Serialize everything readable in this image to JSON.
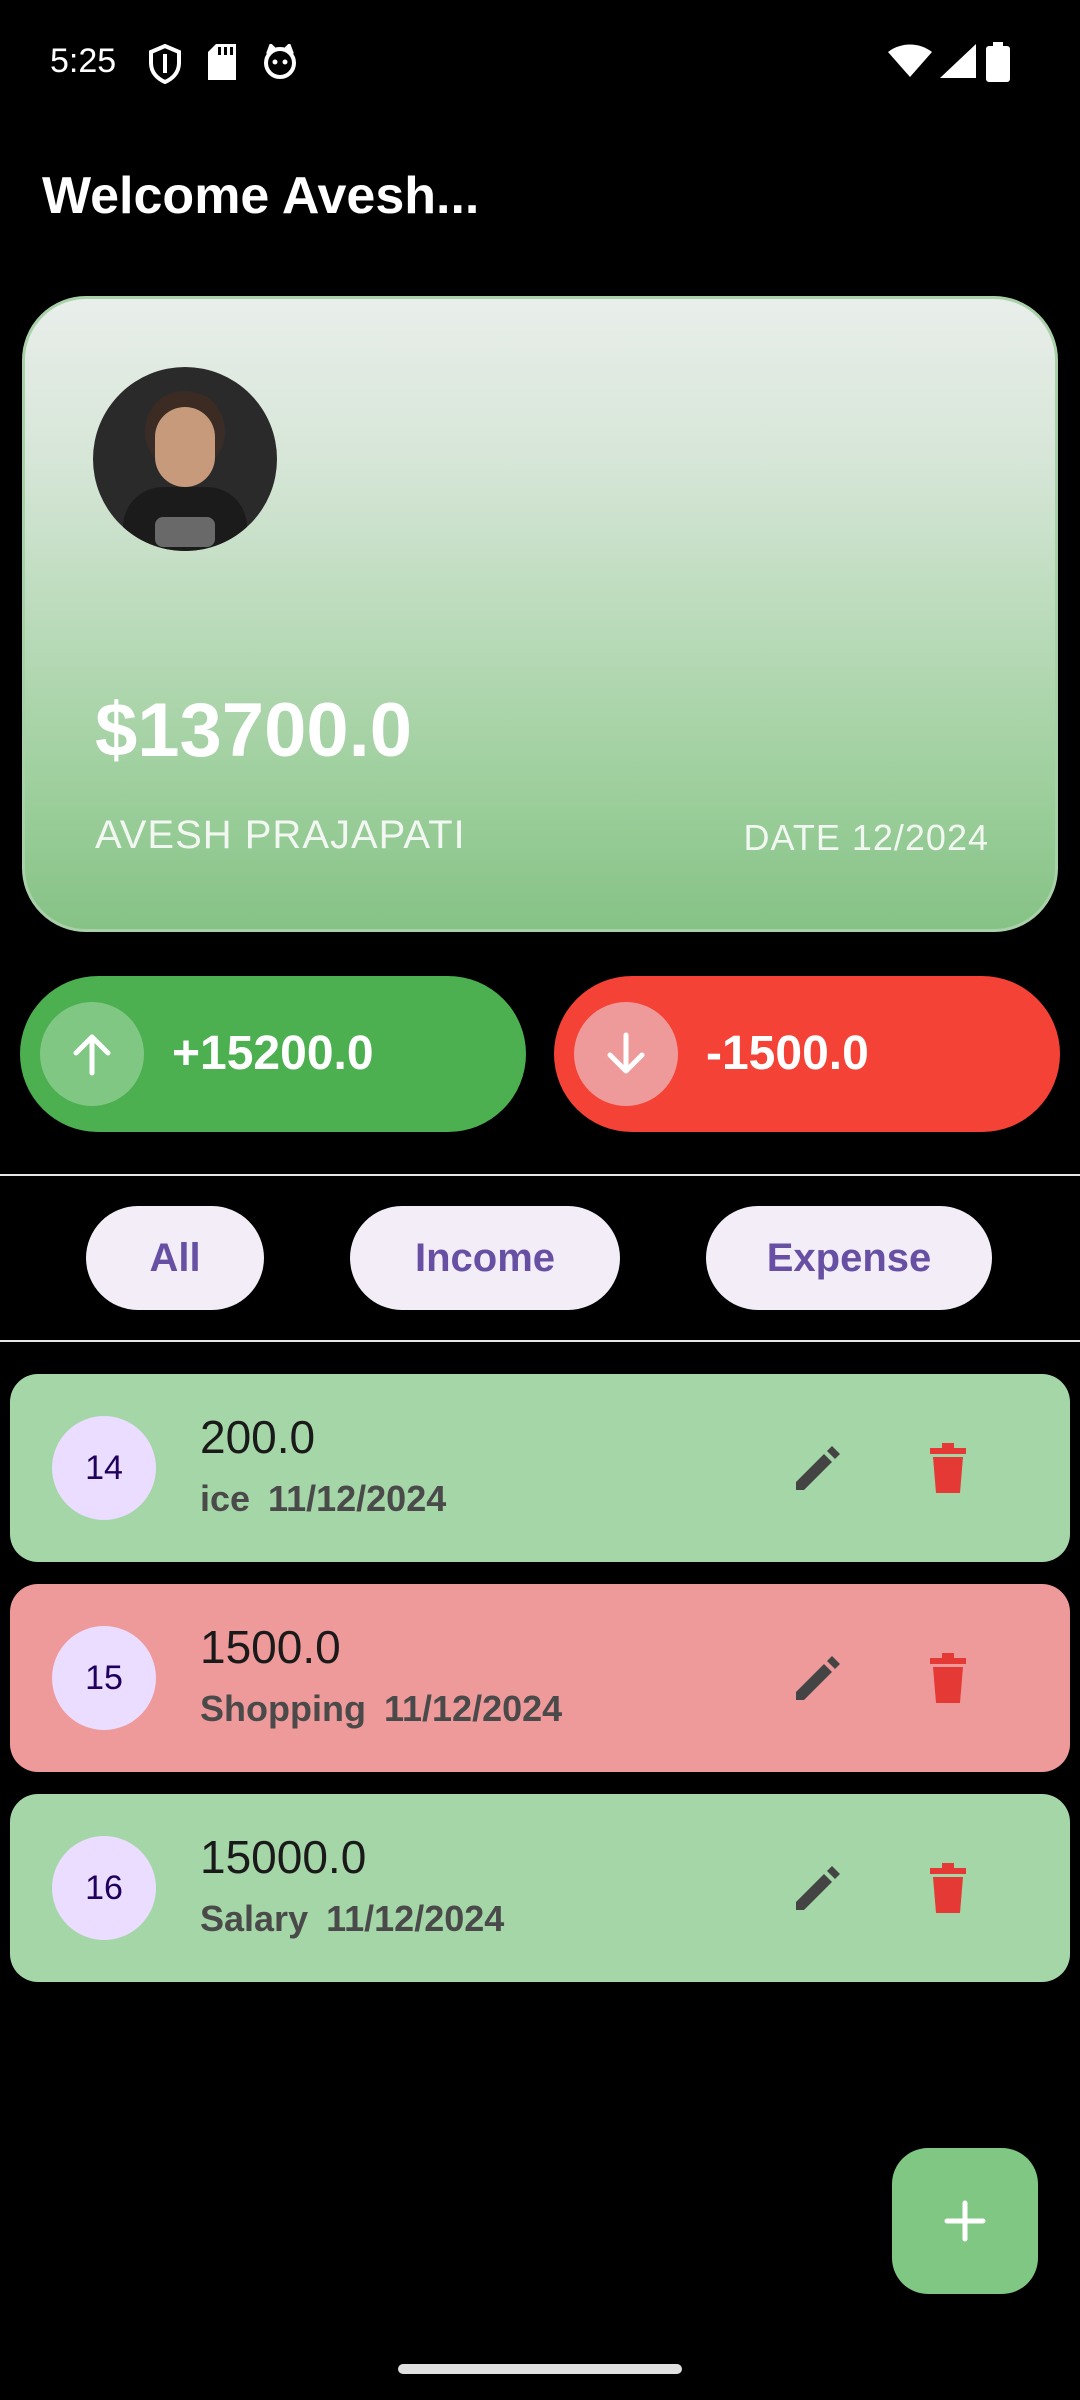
{
  "status_bar": {
    "time": "5:25",
    "icons": [
      "shield-icon",
      "sd-card-icon",
      "cat-icon",
      "wifi-icon",
      "signal-icon",
      "battery-icon"
    ]
  },
  "header": {
    "welcome": "Welcome Avesh..."
  },
  "card": {
    "balance": "$13700.0",
    "name": "AVESH PRAJAPATI",
    "date": "DATE 12/2024",
    "avatar_icon": "profile-avatar"
  },
  "summary": {
    "income": "+15200.0",
    "expense": "-1500.0",
    "income_icon": "arrow-up-icon",
    "expense_icon": "arrow-down-icon"
  },
  "filters": {
    "all": "All",
    "income": "Income",
    "expense": "Expense"
  },
  "transactions": [
    {
      "id": "14",
      "amount": "200.0",
      "category": "ice",
      "date": "11/12/2024",
      "type": "income"
    },
    {
      "id": "15",
      "amount": "1500.0",
      "category": "Shopping",
      "date": "11/12/2024",
      "type": "expense"
    },
    {
      "id": "16",
      "amount": "15000.0",
      "category": "Salary",
      "date": "11/12/2024",
      "type": "income"
    }
  ],
  "colors": {
    "income": "#4caf50",
    "expense": "#f44336",
    "income_light": "#a5d6a7",
    "expense_light": "#ef9a9a",
    "chip_text": "#6750a4",
    "delete_icon": "#e53935"
  },
  "fab": {
    "icon": "plus-icon"
  }
}
